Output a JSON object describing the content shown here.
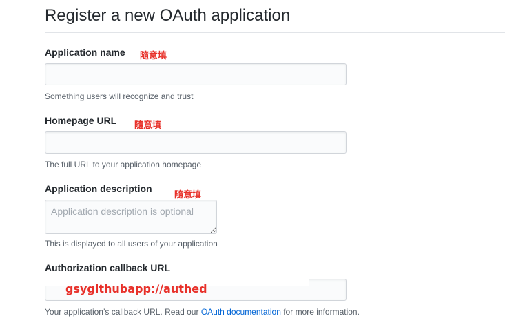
{
  "page": {
    "title": "Register a new OAuth application"
  },
  "form": {
    "app_name": {
      "label": "Application name",
      "annotation": "隨意填",
      "value": "",
      "note": "Something users will recognize and trust"
    },
    "homepage_url": {
      "label": "Homepage URL",
      "annotation": "隨意填",
      "value": "",
      "note": "The full URL to your application homepage"
    },
    "description": {
      "label": "Application description",
      "annotation": "隨意填",
      "placeholder": "Application description is optional",
      "note": "This is displayed to all users of your application"
    },
    "callback_url": {
      "label": "Authorization callback URL",
      "value": "gsygithubapp://authed",
      "note_prefix": "Your application’s callback URL. Read our ",
      "note_link": "OAuth documentation",
      "note_suffix": " for more information."
    }
  },
  "colors": {
    "annotation": "#e8312a",
    "link": "#0366d6",
    "note": "#586069",
    "input_border": "#d1d5da",
    "input_bg": "#fafbfc"
  }
}
